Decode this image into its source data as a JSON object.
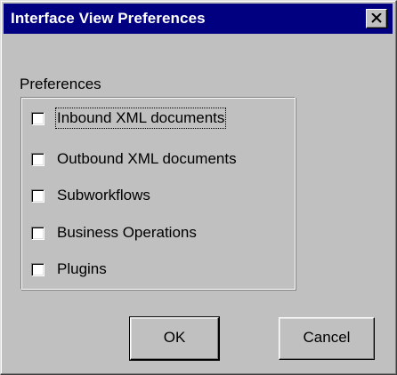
{
  "dialog": {
    "title": "Interface View Preferences",
    "close_icon": "close-icon"
  },
  "preferences": {
    "group_label": "Preferences",
    "items": [
      {
        "label": "Inbound XML documents",
        "checked": false,
        "focused": true
      },
      {
        "label": "Outbound XML documents",
        "checked": false,
        "focused": false
      },
      {
        "label": "Subworkflows",
        "checked": false,
        "focused": false
      },
      {
        "label": "Business Operations",
        "checked": false,
        "focused": false
      },
      {
        "label": "Plugins",
        "checked": false,
        "focused": false
      }
    ]
  },
  "buttons": {
    "ok_label": "OK",
    "cancel_label": "Cancel"
  },
  "colors": {
    "titlebar": "#000080",
    "face": "#c0c0c0"
  }
}
